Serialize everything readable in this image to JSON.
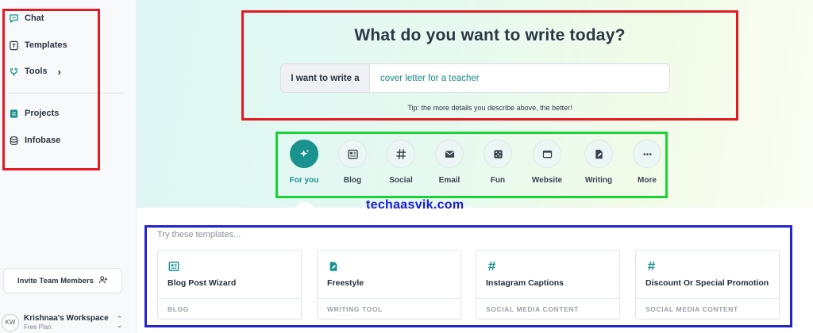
{
  "sidebar": {
    "items": [
      {
        "label": "Chat",
        "icon": "chat-icon"
      },
      {
        "label": "Templates",
        "icon": "template-icon"
      },
      {
        "label": "Tools",
        "icon": "tools-icon",
        "chevron": "›"
      },
      {
        "label": "Projects",
        "icon": "folder-icon"
      },
      {
        "label": "Infobase",
        "icon": "database-icon"
      }
    ],
    "invite_label": "Invite Team Members",
    "workspace": {
      "initials": "KW",
      "name": "Krishnaa's Workspace",
      "plan": "Free Plan"
    }
  },
  "hero": {
    "title": "What do you want to write today?",
    "prompt_label": "I want to write a",
    "prompt_value": "cover letter for a teacher",
    "tip": "Tip: the more details you describe above, the better!"
  },
  "categories": [
    {
      "label": "For you",
      "icon": "sparkle-icon",
      "active": true
    },
    {
      "label": "Blog",
      "icon": "newspaper-icon"
    },
    {
      "label": "Social",
      "icon": "hashtag-icon"
    },
    {
      "label": "Email",
      "icon": "envelope-icon"
    },
    {
      "label": "Fun",
      "icon": "dice-icon"
    },
    {
      "label": "Website",
      "icon": "browser-icon"
    },
    {
      "label": "Writing",
      "icon": "pen-document-icon"
    },
    {
      "label": "More",
      "icon": "ellipsis-icon"
    }
  ],
  "watermark": "techaasvik.com",
  "templates": {
    "heading": "Try these templates...",
    "cards": [
      {
        "title": "Blog Post Wizard",
        "category": "BLOG",
        "icon": "newspaper-icon"
      },
      {
        "title": "Freestyle",
        "category": "WRITING TOOL",
        "icon": "pen-document-icon"
      },
      {
        "title": "Instagram Captions",
        "category": "SOCIAL MEDIA CONTENT",
        "icon": "hashtag-icon"
      },
      {
        "title": "Discount Or Special Promotion",
        "category": "SOCIAL MEDIA CONTENT",
        "icon": "hashtag-icon"
      }
    ]
  },
  "colors": {
    "accent": "#1a938e",
    "annotation_red": "#e01b24",
    "annotation_green": "#19d233",
    "annotation_blue": "#2323d0"
  }
}
